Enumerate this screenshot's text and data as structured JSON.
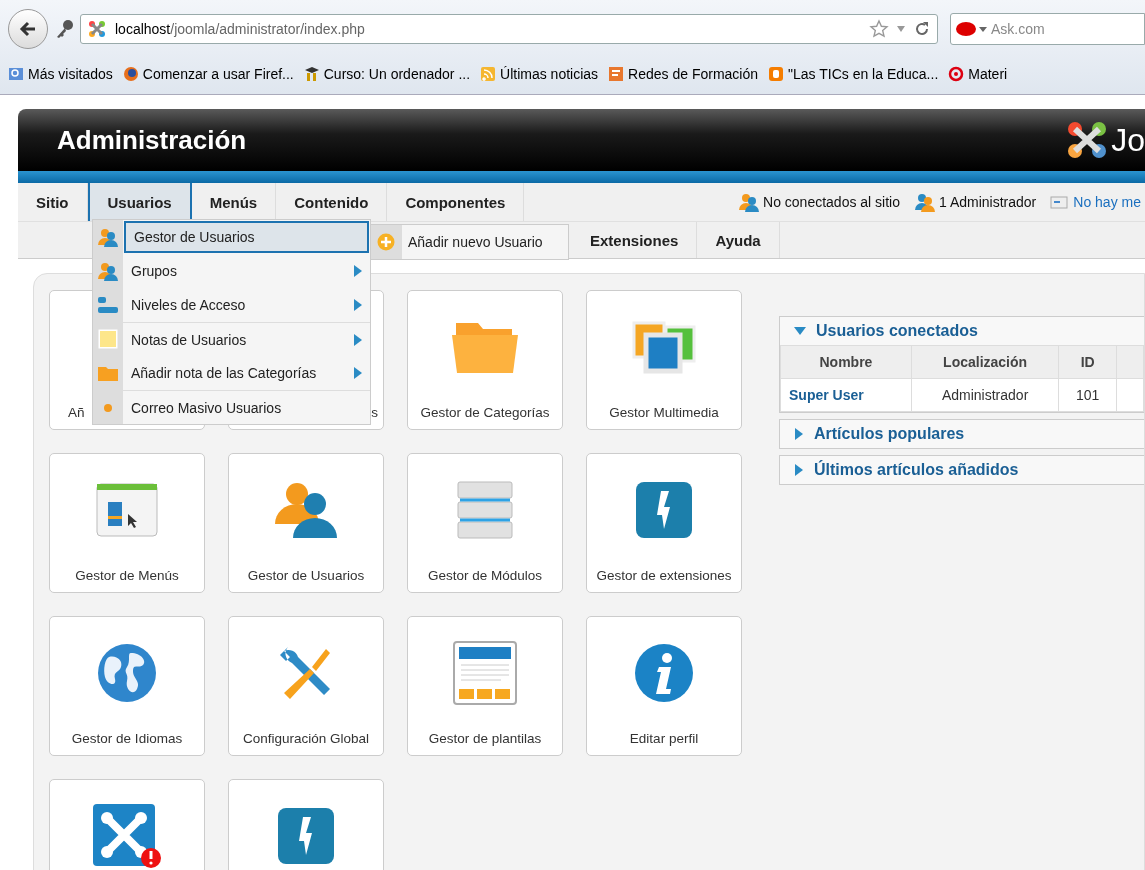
{
  "browser": {
    "url_host": "localhost",
    "url_path": "/joomla/administrator/index.php",
    "search": {
      "placeholder": "Ask.com"
    }
  },
  "bookmarks": [
    {
      "label": "Más visitados"
    },
    {
      "label": "Comenzar a usar Firef..."
    },
    {
      "label": "Curso: Un ordenador ..."
    },
    {
      "label": "Últimas noticias"
    },
    {
      "label": "Redes de Formación"
    },
    {
      "label": "\"Las TICs en la Educa..."
    },
    {
      "label": "Materi"
    }
  ],
  "header": {
    "title": "Administración",
    "logo_text": "Jo"
  },
  "menu_row_1": [
    {
      "label": "Sitio",
      "selected": false
    },
    {
      "label": "Usuarios",
      "selected": true
    },
    {
      "label": "Menús",
      "selected": false
    },
    {
      "label": "Contenido",
      "selected": false
    },
    {
      "label": "Componentes",
      "selected": false
    }
  ],
  "menu_row_2": [
    {
      "label": "Extensiones",
      "selected": false
    },
    {
      "label": "Ayuda",
      "selected": false
    }
  ],
  "status": [
    {
      "kind": "visitors",
      "label": "No conectados al sitio"
    },
    {
      "kind": "admins",
      "label": "1 Administrador"
    },
    {
      "kind": "messages",
      "label": "No hay me"
    }
  ],
  "dropdown": {
    "items": [
      {
        "label": "Gestor de Usuarios",
        "selected": true,
        "has_submenu": false,
        "divider_before": false
      },
      {
        "label": "Grupos",
        "selected": false,
        "has_submenu": true,
        "divider_before": false
      },
      {
        "label": "Niveles de Acceso",
        "selected": false,
        "has_submenu": true,
        "divider_before": false
      },
      {
        "label": "Notas de Usuarios",
        "selected": false,
        "has_submenu": true,
        "divider_before": true
      },
      {
        "label": "Añadir nota de las Categorías",
        "selected": false,
        "has_submenu": true,
        "divider_before": false
      },
      {
        "label": "Correo Masivo Usuarios",
        "selected": false,
        "has_submenu": false,
        "divider_before": true
      }
    ],
    "submenu": {
      "label": "Añadir nuevo Usuario"
    }
  },
  "cards": [
    {
      "kind": "full",
      "label": "Añ"
    },
    {
      "kind": "full",
      "label": "s"
    },
    {
      "kind": "full",
      "label": "Gestor de Categorías"
    },
    {
      "kind": "full",
      "label": "Gestor Multimedia"
    },
    {
      "kind": "full",
      "label": "Gestor de Menús"
    },
    {
      "kind": "full",
      "label": "Gestor de Usuarios"
    },
    {
      "kind": "full",
      "label": "Gestor de Módulos"
    },
    {
      "kind": "full",
      "label": "Gestor de extensiones"
    },
    {
      "kind": "full",
      "label": "Gestor de Idiomas"
    },
    {
      "kind": "full",
      "label": "Configuración Global"
    },
    {
      "kind": "full",
      "label": "Gestor de plantilas"
    },
    {
      "kind": "full",
      "label": "Editar perfil"
    },
    {
      "kind": "cut"
    },
    {
      "kind": "cut"
    }
  ],
  "modules": [
    {
      "title": "Usuarios conectados",
      "expanded": true,
      "table": {
        "columns": [
          "Nombre",
          "Localización",
          "ID"
        ],
        "rows": [
          {
            "cells": [
              "Super User",
              "Administrador",
              "101"
            ]
          }
        ]
      }
    },
    {
      "title": "Artículos populares",
      "expanded": false
    },
    {
      "title": "Últimos artículos añadidos",
      "expanded": false
    }
  ]
}
